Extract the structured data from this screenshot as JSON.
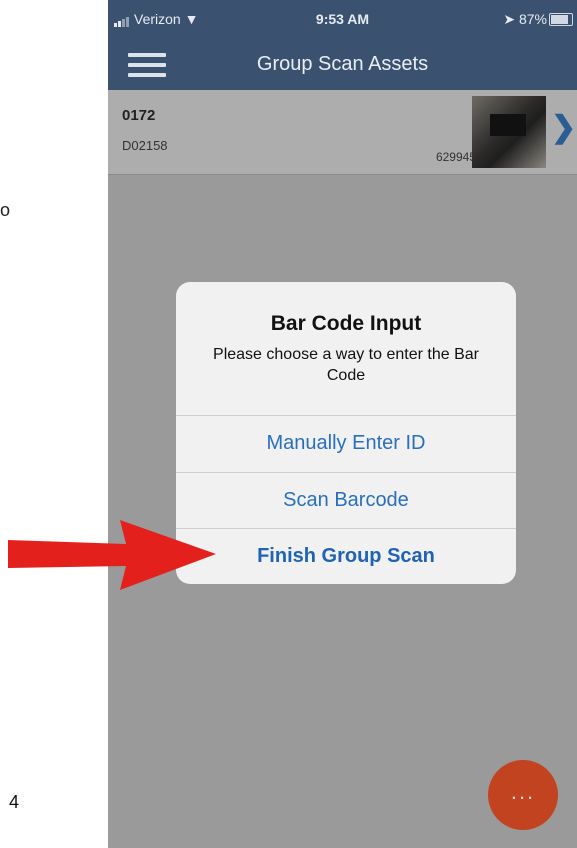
{
  "doc": {
    "fragment": "o",
    "page_number": "4"
  },
  "status_bar": {
    "carrier": "Verizon",
    "time": "9:53 AM",
    "battery": "87%"
  },
  "nav": {
    "title": "Group Scan Assets"
  },
  "asset_row": {
    "number": "0172",
    "subtitle": "D02158",
    "code": "629945"
  },
  "dialog": {
    "title": "Bar Code Input",
    "message": "Please choose a way to enter the Bar Code",
    "options": [
      "Manually Enter ID",
      "Scan Barcode",
      "Finish Group Scan"
    ]
  },
  "fab": {
    "label": "..."
  },
  "colors": {
    "nav_bg": "#3a5270",
    "accent": "#2a6fba",
    "fab": "#c2431f",
    "arrow": "#e3201b"
  },
  "icons": [
    "hamburger-menu-icon",
    "chevron-right-icon",
    "wifi-icon",
    "location-arrow-icon",
    "battery-icon",
    "more-dots-icon"
  ]
}
